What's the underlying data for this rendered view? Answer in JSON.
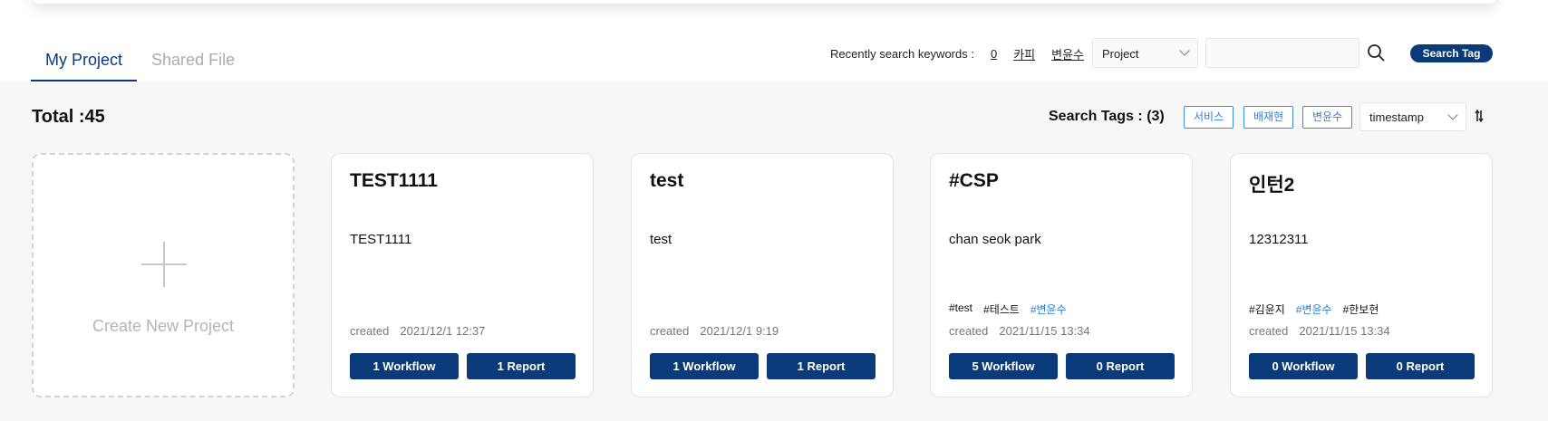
{
  "tabs": [
    {
      "label": "My Project"
    },
    {
      "label": "Shared File"
    }
  ],
  "recent": {
    "label": "Recently search keywords :",
    "keywords": [
      "0",
      "카피",
      "변윤수"
    ]
  },
  "search": {
    "type_selected": "Project",
    "query": "",
    "tag_button": "Search Tag"
  },
  "summary": {
    "total": "Total :45",
    "tags_label": "Search Tags : (3)",
    "tags": [
      "서비스",
      "배재현",
      "변윤수"
    ],
    "sort_selected": "timestamp"
  },
  "create": {
    "label": "Create New Project"
  },
  "projects": [
    {
      "title": "TEST1111",
      "description": "TEST1111",
      "tags": [],
      "created_label": "created",
      "created": "2021/12/1 12:37",
      "workflow": "1 Workflow",
      "report": "1 Report"
    },
    {
      "title": "test",
      "description": "test",
      "tags": [],
      "created_label": "created",
      "created": "2021/12/1 9:19",
      "workflow": "1 Workflow",
      "report": "1 Report"
    },
    {
      "title": "#CSP",
      "description": "chan seok park",
      "tags": [
        "#test",
        "#테스트",
        "#변윤수"
      ],
      "created_label": "created",
      "created": "2021/11/15 13:34",
      "workflow": "5 Workflow",
      "report": "0 Report"
    },
    {
      "title": "인턴2",
      "description": "12312311",
      "tags": [
        "#김윤지",
        "#변윤수",
        "#한보현"
      ],
      "created_label": "created",
      "created": "2021/11/15 13:34",
      "workflow": "0 Workflow",
      "report": "0 Report"
    }
  ],
  "colors": {
    "primary": "#0b3a7a",
    "tag_highlight": "#2a7fd6",
    "background": "#f7f7f7"
  }
}
